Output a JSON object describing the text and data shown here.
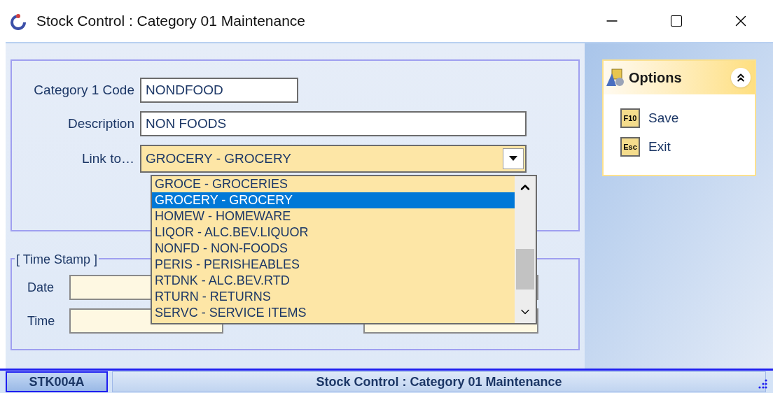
{
  "window": {
    "title": "Stock Control : Category 01 Maintenance"
  },
  "form": {
    "fields": [
      {
        "label": "Category 1 Code",
        "value": "NONDFOOD"
      },
      {
        "label": "Description",
        "value": "NON FOODS"
      }
    ],
    "link": {
      "label": "Link to…",
      "value": "GROCERY - GROCERY",
      "expanded": true,
      "options": [
        {
          "label": "GROCE - GROCERIES",
          "selected": false
        },
        {
          "label": "GROCERY - GROCERY",
          "selected": true
        },
        {
          "label": "HOMEW - HOMEWARE",
          "selected": false
        },
        {
          "label": "LIQOR - ALC.BEV.LIQUOR",
          "selected": false
        },
        {
          "label": "NONFD - NON-FOODS",
          "selected": false
        },
        {
          "label": "PERIS - PERISHEABLES",
          "selected": false
        },
        {
          "label": "RTDNK - ALC.BEV.RTD",
          "selected": false
        },
        {
          "label": "RTURN - RETURNS",
          "selected": false
        },
        {
          "label": "SERVC - SERVICE ITEMS",
          "selected": false
        }
      ]
    }
  },
  "time_stamp": {
    "title": "[ Time Stamp ]",
    "fields": [
      {
        "label": "Date"
      },
      {
        "label": "Time"
      }
    ]
  },
  "options_panel": {
    "title": "Options",
    "expanded": true,
    "items": [
      {
        "key": "F10",
        "label": "Save"
      },
      {
        "key": "Esc",
        "label": "Exit"
      }
    ]
  },
  "status_bar": {
    "code": "STK004A",
    "title": "Stock Control : Category 01 Maintenance"
  }
}
